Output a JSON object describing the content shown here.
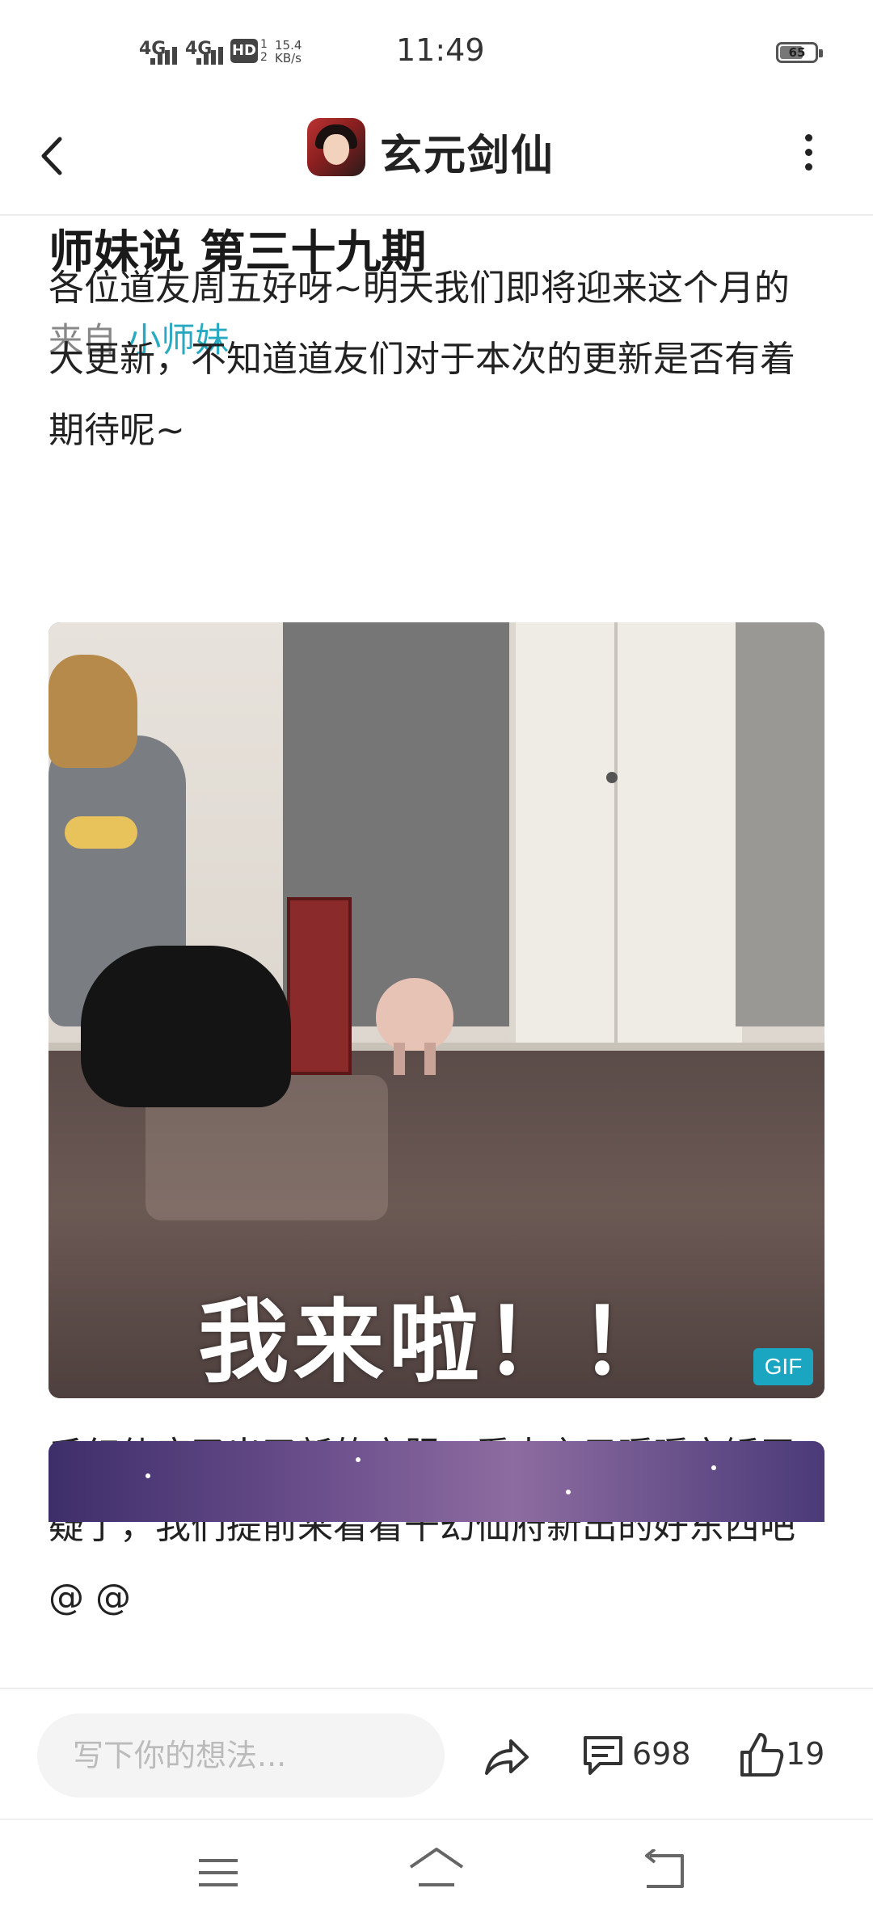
{
  "status_bar": {
    "signal1": "4G",
    "signal2": "4G",
    "hd": "HD",
    "hd_sup": "1",
    "hd_sub": "2",
    "net_speed": "15.4",
    "net_unit": "KB/s",
    "time": "11:49",
    "battery": "65"
  },
  "header": {
    "back_icon": "chevron-left-icon",
    "game_title": "玄元剑仙",
    "more_icon": "more-vertical-icon"
  },
  "article": {
    "title": "师妹说 第三十九期",
    "author_prefix": "来自",
    "author_name": "小师妹",
    "paragraph1": "各位道友周五好呀~明天我们即将迎来这个月的大更新，不知道道友们对于本次的更新是否有着期待呢~",
    "gif_caption": "我来啦！！",
    "gif_badge": "GIF",
    "paragraph2": "千幻仙府又出了新的衣服，看来玄元暖暖实锤无疑了，我们提前来看看千幻仙府新出的好东西吧@ @"
  },
  "action_bar": {
    "placeholder": "写下你的想法...",
    "share_icon": "share-icon",
    "comment_icon": "comment-icon",
    "comment_count": "698",
    "like_icon": "thumbs-up-icon",
    "like_count": "19"
  },
  "nav_bar": {
    "menu_icon": "menu-icon",
    "home_icon": "home-icon",
    "back_icon": "back-icon"
  },
  "colors": {
    "accent": "#27a9c2",
    "gif_badge": "#1aa6c0"
  }
}
